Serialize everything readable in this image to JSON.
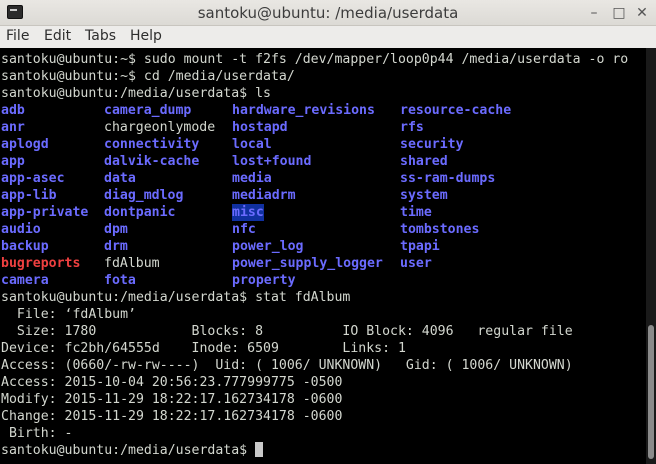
{
  "window": {
    "title": "santoku@ubuntu: /media/userdata",
    "buttons": {
      "minimize": "–",
      "maximize": "□",
      "close": "✕"
    }
  },
  "menu": [
    "File",
    "Edit",
    "Tabs",
    "Help"
  ],
  "terminal": {
    "lines": [
      "santoku@ubuntu:~$ sudo mount -t f2fs /dev/mapper/loop0p44 /media/userdata -o ro",
      "santoku@ubuntu:~$ cd /media/userdata/",
      "santoku@ubuntu:/media/userdata$ ls"
    ],
    "ls_columns": [
      [
        "adb",
        "anr",
        "aplogd",
        "app",
        "app-asec",
        "app-lib",
        "app-private",
        "audio",
        "backup",
        "bugreports",
        "camera"
      ],
      [
        "camera_dump",
        "chargeonlymode",
        "connectivity",
        "dalvik-cache",
        "data",
        "diag_mdlog",
        "dontpanic",
        "dpm",
        "drm",
        "fdAlbum",
        "fota"
      ],
      [
        "hardware_revisions",
        "hostapd",
        "local",
        "lost+found",
        "media",
        "mediadrm",
        "misc",
        "nfc",
        "power_log",
        "power_supply_logger",
        "property"
      ],
      [
        "resource-cache",
        "rfs",
        "security",
        "shared",
        "ss-ram-dumps",
        "system",
        "time",
        "tombstones",
        "tpapi",
        "user"
      ]
    ],
    "stat_lines": [
      "santoku@ubuntu:/media/userdata$ stat fdAlbum",
      "  File: ‘fdAlbum’",
      "  Size: 1780            Blocks: 8          IO Block: 4096   regular file",
      "Device: fc2bh/64555d    Inode: 6509        Links: 1",
      "Access: (0660/-rw-rw----)  Uid: ( 1006/ UNKNOWN)   Gid: ( 1006/ UNKNOWN)",
      "Access: 2015-10-04 20:56:23.777999775 -0500",
      "Modify: 2015-11-29 18:22:17.162734178 -0600",
      "Change: 2015-11-29 18:22:17.162734178 -0600",
      " Birth: -"
    ],
    "prompt": "santoku@ubuntu:/media/userdata$ "
  }
}
